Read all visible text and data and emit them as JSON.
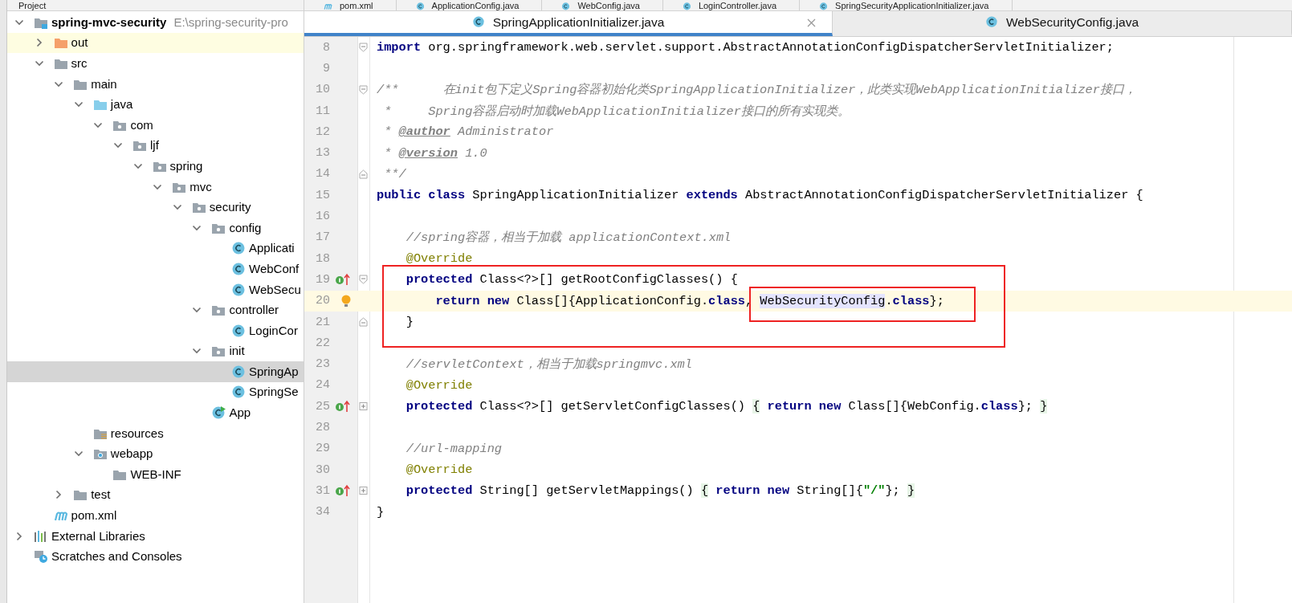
{
  "project_panel": {
    "title": "Project",
    "tree": [
      {
        "label": "spring-mvc-security",
        "path": "E:\\spring-security-pro",
        "kind": "module",
        "expanded": true,
        "selected": false,
        "children": [
          {
            "label": "out",
            "kind": "excluded",
            "expanded": false,
            "selected": false
          },
          {
            "label": "src",
            "kind": "folder",
            "expanded": true,
            "selected": false,
            "children": [
              {
                "label": "main",
                "kind": "folder",
                "expanded": true,
                "selected": false,
                "children": [
                  {
                    "label": "java",
                    "kind": "source",
                    "expanded": true,
                    "selected": false,
                    "children": [
                      {
                        "label": "com",
                        "kind": "package",
                        "expanded": true,
                        "selected": false,
                        "children": [
                          {
                            "label": "ljf",
                            "kind": "package",
                            "expanded": true,
                            "selected": false,
                            "children": [
                              {
                                "label": "spring",
                                "kind": "package",
                                "expanded": true,
                                "selected": false,
                                "children": [
                                  {
                                    "label": "mvc",
                                    "kind": "package",
                                    "expanded": true,
                                    "selected": false,
                                    "children": [
                                      {
                                        "label": "security",
                                        "kind": "package",
                                        "expanded": true,
                                        "selected": false,
                                        "children": [
                                          {
                                            "label": "config",
                                            "kind": "package",
                                            "expanded": true,
                                            "selected": false,
                                            "children": [
                                              {
                                                "label": "Applicati",
                                                "kind": "class",
                                                "selected": false
                                              },
                                              {
                                                "label": "WebConf",
                                                "kind": "class",
                                                "selected": false
                                              },
                                              {
                                                "label": "WebSecu",
                                                "kind": "class",
                                                "selected": false
                                              }
                                            ]
                                          },
                                          {
                                            "label": "controller",
                                            "kind": "package",
                                            "expanded": true,
                                            "selected": false,
                                            "children": [
                                              {
                                                "label": "LoginCor",
                                                "kind": "class",
                                                "selected": false
                                              }
                                            ]
                                          },
                                          {
                                            "label": "init",
                                            "kind": "package",
                                            "expanded": true,
                                            "selected": false,
                                            "children": [
                                              {
                                                "label": "SpringAp",
                                                "kind": "class",
                                                "selected": true
                                              },
                                              {
                                                "label": "SpringSe",
                                                "kind": "class",
                                                "selected": false
                                              }
                                            ]
                                          },
                                          {
                                            "label": "App",
                                            "kind": "app",
                                            "selected": false
                                          }
                                        ]
                                      }
                                    ]
                                  }
                                ]
                              }
                            ]
                          }
                        ]
                      }
                    ]
                  },
                  {
                    "label": "resources",
                    "kind": "resources",
                    "selected": false
                  },
                  {
                    "label": "webapp",
                    "kind": "webapp",
                    "expanded": true,
                    "selected": false,
                    "children": [
                      {
                        "label": "WEB-INF",
                        "kind": "folder",
                        "selected": false
                      }
                    ]
                  }
                ]
              },
              {
                "label": "test",
                "kind": "folder",
                "expanded": false,
                "selected": false
              }
            ]
          },
          {
            "label": "pom.xml",
            "kind": "maven",
            "selected": false
          }
        ]
      },
      {
        "label": "External Libraries",
        "kind": "library",
        "expanded": false,
        "selected": false
      },
      {
        "label": "Scratches and Consoles",
        "kind": "scratches",
        "selected": false
      }
    ]
  },
  "editor": {
    "tabs_top": [
      {
        "label": "pom.xml",
        "kind": "maven"
      },
      {
        "label": "ApplicationConfig.java",
        "kind": "class"
      },
      {
        "label": "WebConfig.java",
        "kind": "class"
      },
      {
        "label": "LoginController.java",
        "kind": "class"
      },
      {
        "label": "SpringSecurityApplicationInitializer.java",
        "kind": "class"
      }
    ],
    "tabs": [
      {
        "label": "SpringApplicationInitializer.java",
        "selected": true
      },
      {
        "label": "WebSecurityConfig.java",
        "selected": false
      }
    ],
    "lines": [
      {
        "number": "8",
        "fold": {
          "kind": "start"
        },
        "tokens": [
          {
            "kind": "keyword",
            "text": "import"
          },
          {
            "kind": "plain",
            "text": " org.springframework.web.servlet.support.AbstractAnnotationConfigDispatcherServletInitializer;"
          }
        ]
      },
      {
        "number": "9"
      },
      {
        "number": "10",
        "fold": {
          "kind": "start"
        },
        "tokens": [
          {
            "kind": "comment",
            "text": "/**      在init包下定义Spring容器初始化类SpringApplicationInitializer，此类实现WebApplicationInitializer接口，"
          }
        ]
      },
      {
        "number": "11",
        "tokens": [
          {
            "kind": "comment",
            "text": " *     Spring容器启动时加载WebApplicationInitializer接口的所有实现类。"
          }
        ]
      },
      {
        "number": "12",
        "tokens": [
          {
            "kind": "comment",
            "text": " * "
          },
          {
            "kind": "doctag",
            "text": "@author"
          },
          {
            "kind": "comment",
            "text": " Administrator"
          }
        ]
      },
      {
        "number": "13",
        "tokens": [
          {
            "kind": "comment",
            "text": " * "
          },
          {
            "kind": "doctag",
            "text": "@version"
          },
          {
            "kind": "comment",
            "text": " 1.0"
          }
        ]
      },
      {
        "number": "14",
        "fold": {
          "kind": "end"
        },
        "tokens": [
          {
            "kind": "comment",
            "text": " **/"
          }
        ]
      },
      {
        "number": "15",
        "tokens": [
          {
            "kind": "keyword",
            "text": "public class"
          },
          {
            "kind": "plain",
            "text": " SpringApplicationInitializer "
          },
          {
            "kind": "keyword",
            "text": "extends"
          },
          {
            "kind": "plain",
            "text": " AbstractAnnotationConfigDispatcherServletInitializer {"
          }
        ]
      },
      {
        "number": "16"
      },
      {
        "number": "17",
        "tokens": [
          {
            "kind": "comment",
            "text": "    //spring容器，相当于加载 applicationContext.xml"
          }
        ]
      },
      {
        "number": "18",
        "tokens": [
          {
            "kind": "annotation",
            "text": "    @Override"
          }
        ]
      },
      {
        "number": "19",
        "marker": {
          "kind": "implements"
        },
        "fold": {
          "kind": "start"
        },
        "boxed": true,
        "tokens": [
          {
            "kind": "keyword",
            "text": "    protected"
          },
          {
            "kind": "plain",
            "text": " Class<?>[] getRootConfigClasses() {"
          }
        ]
      },
      {
        "number": "20",
        "marker": {
          "kind": "bulb"
        },
        "current": true,
        "boxed": true,
        "tokens": [
          {
            "kind": "keyword",
            "text": "        return new"
          },
          {
            "kind": "plain",
            "text": " Class[]{ApplicationConfig."
          },
          {
            "kind": "keyword",
            "text": "class"
          },
          {
            "kind": "plain",
            "text": ", "
          },
          {
            "kind": "highlight",
            "text": "WebSecurityConfig",
            "boxed": true
          },
          {
            "kind": "plain",
            "text": "."
          },
          {
            "kind": "keyword",
            "text": "class"
          },
          {
            "kind": "plain",
            "text": "};"
          }
        ]
      },
      {
        "number": "21",
        "fold": {
          "kind": "end"
        },
        "boxed": true,
        "tokens": [
          {
            "kind": "plain",
            "text": "    }"
          }
        ]
      },
      {
        "number": "22"
      },
      {
        "number": "23",
        "tokens": [
          {
            "kind": "comment",
            "text": "    //servletContext，相当于加载springmvc.xml"
          }
        ]
      },
      {
        "number": "24",
        "tokens": [
          {
            "kind": "annotation",
            "text": "    @Override"
          }
        ]
      },
      {
        "number": "25",
        "marker": {
          "kind": "implements"
        },
        "fold": {
          "kind": "collapsed"
        },
        "tokens": [
          {
            "kind": "keyword",
            "text": "    protected"
          },
          {
            "kind": "plain",
            "text": " Class<?>[] getServletConfigClasses() "
          },
          {
            "kind": "folded",
            "text": "{"
          },
          {
            "kind": "keyword",
            "text": " return new"
          },
          {
            "kind": "plain",
            "text": " Class[]{WebConfig."
          },
          {
            "kind": "keyword",
            "text": "class"
          },
          {
            "kind": "plain",
            "text": "}; "
          },
          {
            "kind": "folded",
            "text": "}"
          }
        ]
      },
      {
        "number": "28"
      },
      {
        "number": "29",
        "tokens": [
          {
            "kind": "comment",
            "text": "    //url-mapping"
          }
        ]
      },
      {
        "number": "30",
        "tokens": [
          {
            "kind": "annotation",
            "text": "    @Override"
          }
        ]
      },
      {
        "number": "31",
        "marker": {
          "kind": "implements"
        },
        "fold": {
          "kind": "collapsed"
        },
        "tokens": [
          {
            "kind": "keyword",
            "text": "    protected"
          },
          {
            "kind": "plain",
            "text": " String[] getServletMappings() "
          },
          {
            "kind": "folded",
            "text": "{"
          },
          {
            "kind": "keyword",
            "text": " return new"
          },
          {
            "kind": "plain",
            "text": " String[]{"
          },
          {
            "kind": "string",
            "text": "\"/\""
          },
          {
            "kind": "plain",
            "text": "}; "
          },
          {
            "kind": "folded",
            "text": "}"
          }
        ]
      },
      {
        "number": "34",
        "tokens": [
          {
            "kind": "plain",
            "text": "}"
          }
        ]
      }
    ]
  }
}
